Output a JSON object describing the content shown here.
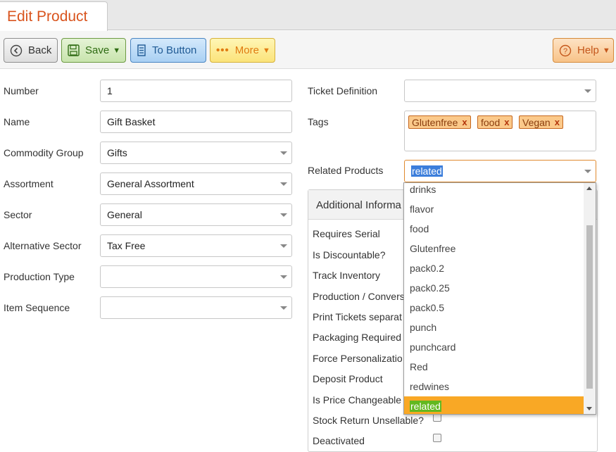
{
  "tab": {
    "title": "Edit Product"
  },
  "toolbar": {
    "back_label": "Back",
    "save_label": "Save",
    "tobutton_label": "To Button",
    "more_label": "More",
    "help_label": "Help",
    "icons": {
      "back": "circle-chevron-left-icon",
      "save": "floppy-disk-icon",
      "tobutton": "list-icon",
      "more": "dots-icon",
      "help": "question-circle-icon"
    }
  },
  "form_left": {
    "number": {
      "label": "Number",
      "value": "1"
    },
    "name": {
      "label": "Name",
      "value": "Gift Basket"
    },
    "commodity_group": {
      "label": "Commodity Group",
      "value": "Gifts"
    },
    "assortment": {
      "label": "Assortment",
      "value": "General Assortment"
    },
    "sector": {
      "label": "Sector",
      "value": "General"
    },
    "alternative_sector": {
      "label": "Alternative Sector",
      "value": "Tax Free"
    },
    "production_type": {
      "label": "Production Type",
      "value": ""
    },
    "item_sequence": {
      "label": "Item Sequence",
      "value": ""
    }
  },
  "form_right": {
    "ticket_definition": {
      "label": "Ticket Definition",
      "value": ""
    },
    "tags": {
      "label": "Tags",
      "items": [
        "Glutenfree",
        "food",
        "Vegan"
      ],
      "remove_glyph": "x"
    },
    "related_products": {
      "label": "Related Products",
      "value": "related"
    }
  },
  "panel": {
    "title": "Additional Informa",
    "rows": [
      "Requires Serial",
      "Is Discountable?",
      "Track Inventory",
      "Production / Convers",
      "Print Tickets separat",
      "Packaging Required",
      "Force Personalizatio",
      "Deposit Product",
      "Is Price Changeable",
      "Stock Return Unsellable?",
      "Deactivated"
    ]
  },
  "dropdown": {
    "options": [
      "drinks",
      "flavor",
      "food",
      "Glutenfree",
      "pack0.2",
      "pack0.25",
      "pack0.5",
      "punch",
      "punchcard",
      "Red",
      "redwines",
      "related"
    ],
    "active": "related"
  },
  "colors": {
    "accent": "#d9541e",
    "highlight": "#f9a825",
    "match": "#62b81f"
  }
}
